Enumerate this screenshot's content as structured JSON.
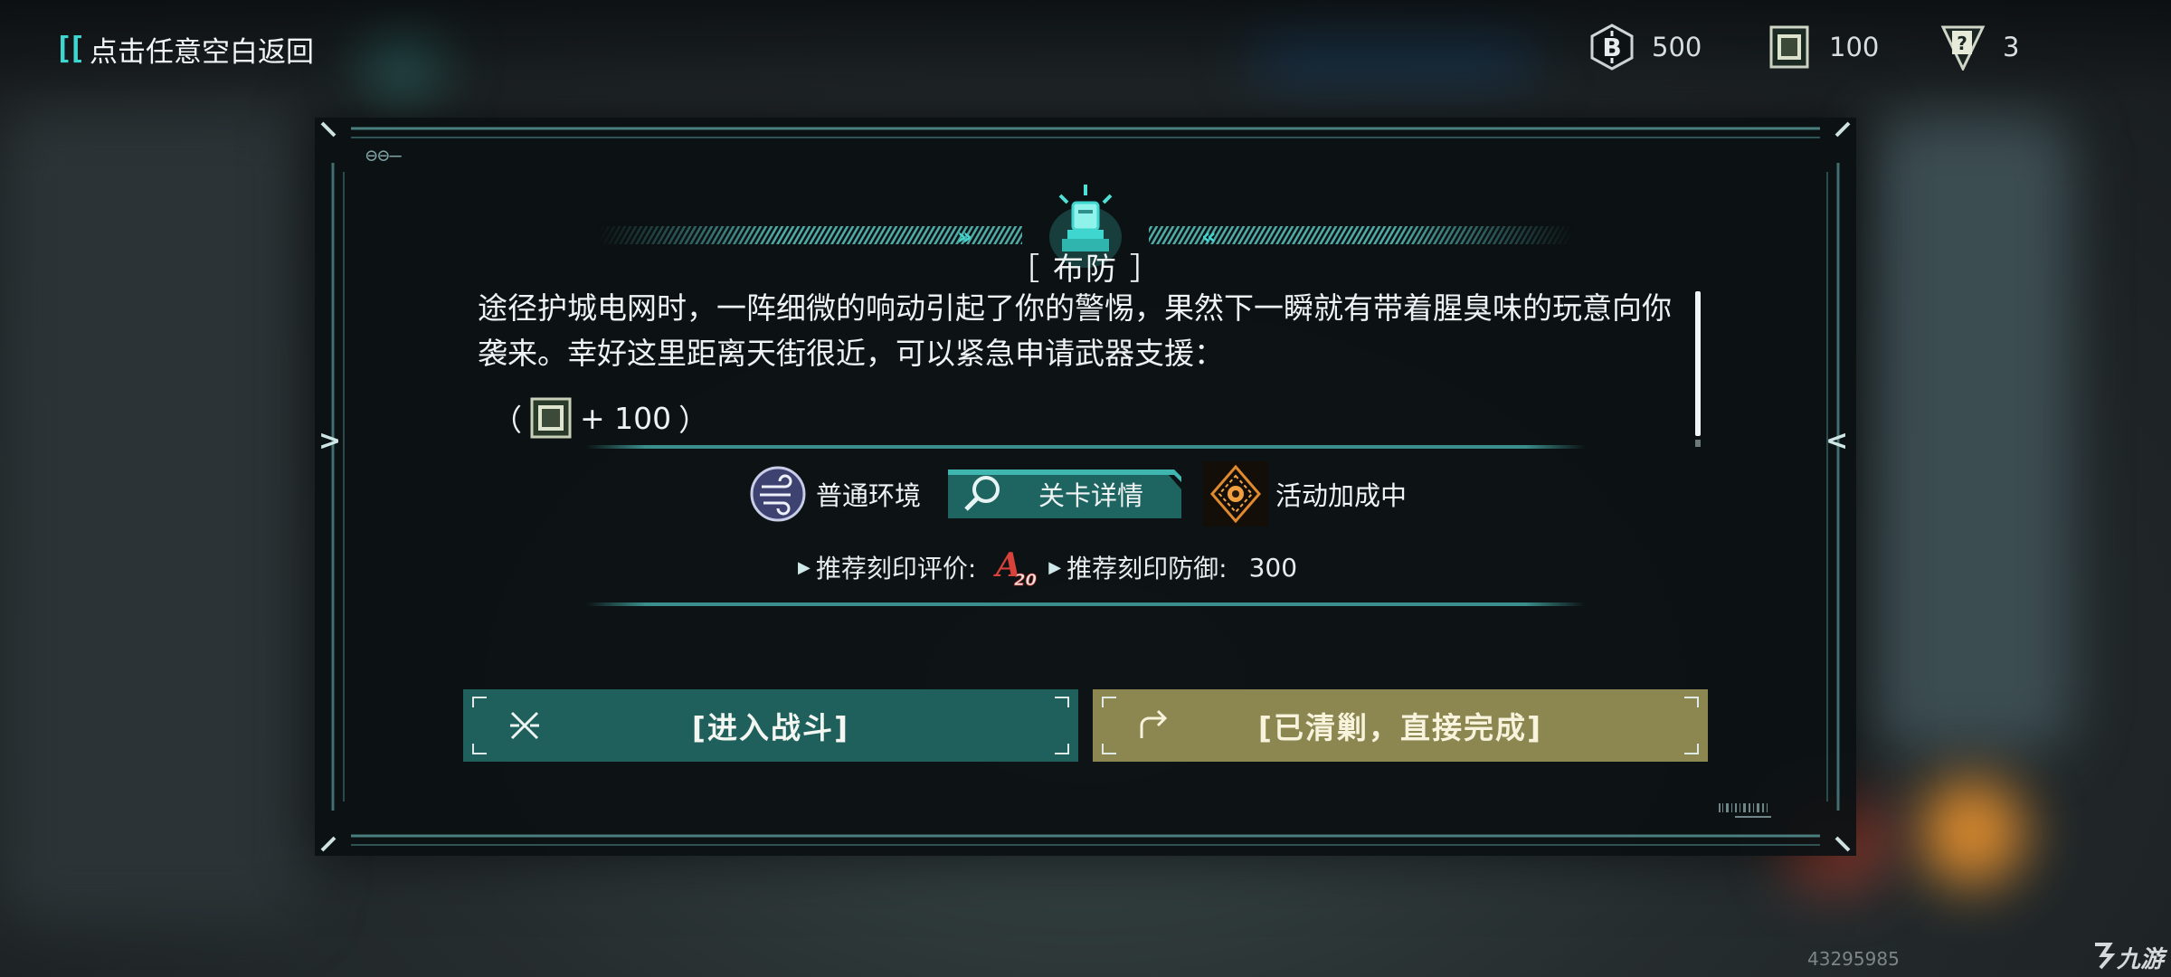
{
  "top_left": {
    "back_hint": "点击任意空白返回"
  },
  "currencies": [
    {
      "icon": "b-coin-icon",
      "value": "500"
    },
    {
      "icon": "chip-card-icon",
      "value": "100"
    },
    {
      "icon": "mystery-card-icon",
      "value": "3"
    }
  ],
  "panel": {
    "title": "［ 布防 ］",
    "description": "途径护城电网时，一阵细微的响动引起了你的警惕，果然下一瞬就有带着腥臭味的玩意向你袭来。幸好这里距离天街很近，可以紧急申请武器支援：",
    "reward": {
      "open": "（",
      "amount": "+ 100",
      "close": "）"
    },
    "tags": {
      "environment": "普通环境",
      "detail_button": "关卡详情",
      "bonus": "活动加成中"
    },
    "recommend": {
      "rating_label": "推荐刻印评价:",
      "rating_rank": "A",
      "rating_level": "20",
      "defense_label": "推荐刻印防御:",
      "defense_value": "300"
    },
    "buttons": {
      "fight": "[进入战斗]",
      "skip": "[已清剿，直接完成]"
    }
  },
  "footer": {
    "image_id": "43295985",
    "logo": "九游"
  },
  "colors": {
    "accent": "#3fd6cf",
    "fight_button": "#1f5f5c",
    "skip_button": "#8c8650",
    "panel_bg": "#0b1012"
  }
}
